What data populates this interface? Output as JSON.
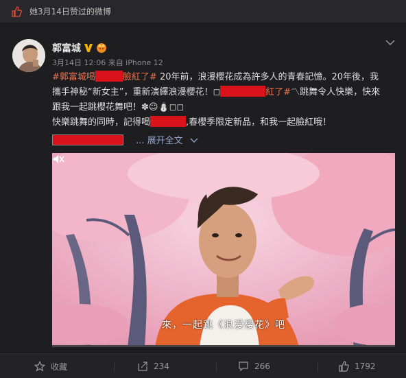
{
  "header": {
    "like_text": "她3月14日赞过的微博"
  },
  "post": {
    "author": "郭富城",
    "meta": "3月14日 12:06 来自 iPhone 12",
    "line1": {
      "tag": "#郭富城喝",
      "tag_end": "臉紅了#",
      "text": " 20年前，浪漫櫻花成為許多人的青春記憶。20年後，我"
    },
    "line2": {
      "a": "攜手神秘“新女主”，重新演繹浪漫櫻花！◻",
      "tag": "紅了#",
      "b": "〽跳舞令人快樂，快來"
    },
    "line3": {
      "text": "跟我一起跳櫻花舞吧！✽☺⛄◻◻"
    },
    "line4": {
      "a": "快樂跳舞的同時，記得喝",
      "b": ",春櫻季限定新品，和我一起臉紅哦！"
    },
    "expand": "... 展开全文",
    "video": {
      "subtitle": "來，一起跳《浪漫櫻花》吧",
      "progress": 0.0
    }
  },
  "actions": {
    "collect": "收藏",
    "repost": "234",
    "comment": "266",
    "like": "1792"
  }
}
